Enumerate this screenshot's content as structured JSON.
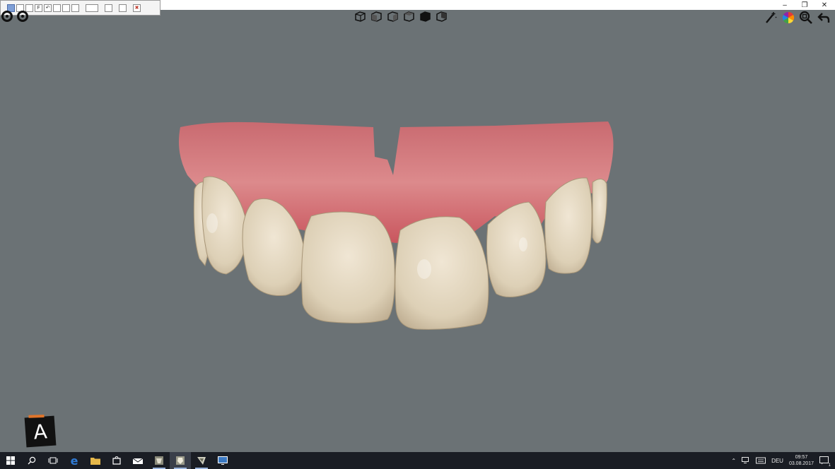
{
  "toolbar": {
    "buttons": [
      "",
      "",
      "",
      "F",
      "↶",
      "",
      "",
      "",
      "",
      "",
      "",
      ""
    ]
  },
  "taskbar": {
    "language": "DEU",
    "time": "09:57",
    "date": "03.08.2017",
    "notification_count": "1"
  },
  "logo": {
    "letter": "A"
  },
  "colors": {
    "background": "#6b7275",
    "taskbar": "#1a1d24",
    "gum": "#d4787c",
    "tooth": "#e8dcc4",
    "edge_icon": "#2f7bd6",
    "folder_icon": "#e6b84a"
  },
  "icons": {
    "top_left": [
      "target-icon",
      "eye-icon"
    ],
    "views": [
      "cube-front-icon",
      "cube-left-icon",
      "cube-right-icon",
      "cube-top-icon",
      "cube-solid-icon",
      "cube-back-icon"
    ],
    "top_right": [
      "magic-wand-icon",
      "color-wheel-icon",
      "zoom-icon",
      "undo-arrow-icon"
    ]
  }
}
